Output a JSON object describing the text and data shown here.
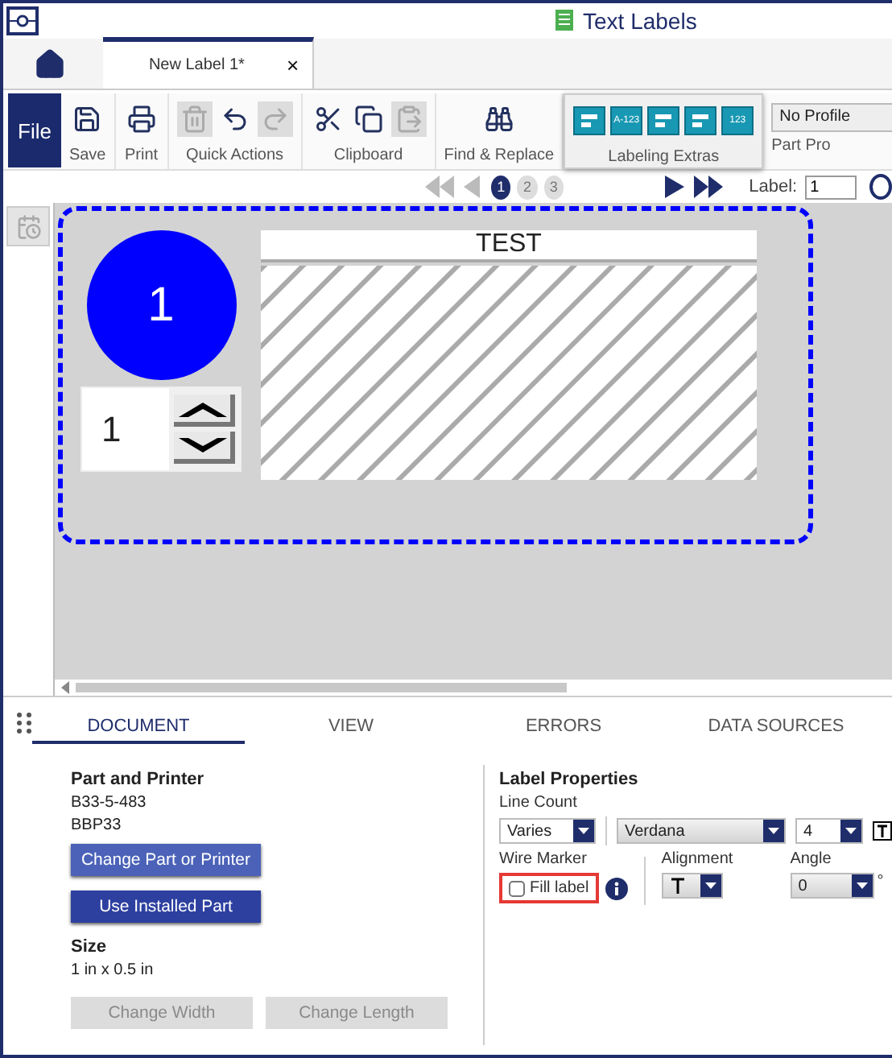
{
  "window": {
    "title": "Text Labels"
  },
  "doc_tabs": [
    {
      "label": "New Label 1*",
      "close": "×",
      "selected": true
    }
  ],
  "ribbon": {
    "file": "File",
    "groups": [
      {
        "label": "Save",
        "kind": "plain",
        "buttons": [
          {
            "disabled": false
          }
        ]
      },
      {
        "label": "Print",
        "kind": "plain",
        "buttons": [
          {
            "disabled": false
          }
        ]
      },
      {
        "label": "Quick Actions",
        "kind": "plain",
        "buttons": [
          {
            "disabled": true
          },
          {
            "disabled": false
          },
          {
            "disabled": true
          }
        ]
      },
      {
        "label": "Clipboard",
        "kind": "plain",
        "buttons": [
          {
            "disabled": false
          },
          {
            "disabled": false
          },
          {
            "disabled": true
          }
        ]
      },
      {
        "label": "Find & Replace",
        "kind": "plain",
        "buttons": [
          {
            "disabled": false
          }
        ]
      },
      {
        "label": "Labeling Extras",
        "kind": "extras",
        "buttons": [
          {
            "kind": "graphic"
          },
          {
            "kind": "text",
            "text": "A-123"
          },
          {
            "kind": "graphic"
          },
          {
            "kind": "graphic"
          },
          {
            "kind": "text",
            "text": "123"
          }
        ]
      },
      {
        "label": "Part Pro",
        "kind": "profile",
        "dropdown": "No Profile"
      }
    ]
  },
  "nav": {
    "back": [
      {
        "kind": "first",
        "disabled": true
      },
      {
        "kind": "prev",
        "disabled": true
      }
    ],
    "pages": [
      {
        "label": "1",
        "selected": true
      },
      {
        "label": "2",
        "selected": false
      },
      {
        "label": "3",
        "selected": false
      }
    ],
    "forward": [
      {
        "kind": "next",
        "disabled": false
      },
      {
        "kind": "last",
        "disabled": false
      }
    ],
    "label_field": {
      "label": "Label:",
      "value": "1"
    }
  },
  "canvas": {
    "number": "1",
    "spinner_value": "1",
    "header": "TEST"
  },
  "panel": {
    "tabs": [
      {
        "label": "DOCUMENT",
        "selected": true
      },
      {
        "label": "VIEW",
        "selected": false
      },
      {
        "label": "ERRORS",
        "selected": false
      },
      {
        "label": "DATA SOURCES",
        "selected": false
      }
    ],
    "part": {
      "title": "Part and Printer",
      "lines": [
        "B33-5-483",
        "BBP33"
      ],
      "buttons": [
        {
          "label": "Change Part or Printer",
          "kind": "accent"
        },
        {
          "label": "Use Installed Part",
          "kind": "primary"
        }
      ]
    },
    "size": {
      "title": "Size",
      "value": "1 in x 0.5 in",
      "buttons": [
        {
          "label": "Change Width",
          "disabled": true
        },
        {
          "label": "Change Length",
          "disabled": true
        }
      ]
    },
    "properties": {
      "title": "Label Properties",
      "line_count": {
        "label": "Line Count",
        "value": "Varies"
      },
      "font": "Verdana",
      "font_size": "4",
      "wire_marker": {
        "label": "Wire Marker",
        "checkbox": {
          "label": "Fill label",
          "checked": false,
          "highlighted": true
        }
      },
      "alignment": {
        "label": "Alignment"
      },
      "angle": {
        "label": "Angle",
        "value": "0",
        "unit": "°"
      }
    }
  }
}
